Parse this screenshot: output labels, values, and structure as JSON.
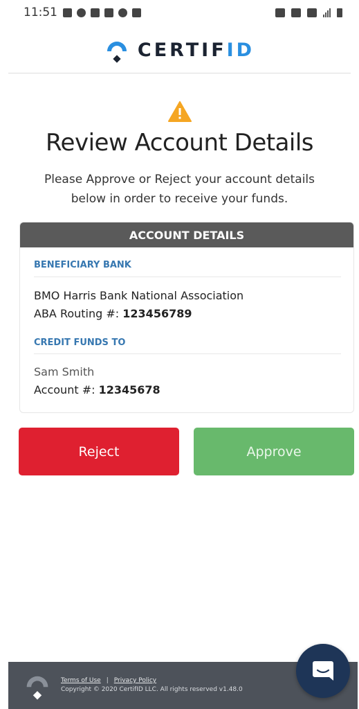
{
  "status_bar": {
    "time": "11:51",
    "icons_left": [
      "sim-icon",
      "chat-icon",
      "mail-icon",
      "message-icon",
      "sync-icon",
      "image-icon"
    ],
    "icons_right": [
      "alarm-icon",
      "mute-icon",
      "wifi-icon",
      "signal-icon",
      "battery-icon"
    ]
  },
  "header": {
    "brand_main": "CERTIF",
    "brand_accent": "ID",
    "brand_color": "#2a8fe0",
    "brand_dark": "#1b2331"
  },
  "page": {
    "warning_icon": "warning-triangle-icon",
    "warning_color": "#f5a623",
    "title": "Review Account Details",
    "subtitle": "Please Approve or Reject your account details below in order to receive your funds."
  },
  "account_card": {
    "heading": "ACCOUNT DETAILS",
    "beneficiary": {
      "label": "BENEFICIARY BANK",
      "bank_name": "BMO Harris Bank National Association",
      "routing_label": "ABA Routing #:",
      "routing_value": "123456789"
    },
    "credit": {
      "label": "CREDIT FUNDS TO",
      "name": "Sam Smith",
      "account_label": "Account #:",
      "account_value": "12345678"
    }
  },
  "actions": {
    "reject_label": "Reject",
    "approve_label": "Approve",
    "reject_color": "#df2030",
    "approve_color": "#68b96c"
  },
  "footer": {
    "terms_label": "Terms of Use",
    "separator": "|",
    "privacy_label": "Privacy Policy",
    "copyright": "Copyright © 2020 CertifID LLC. All rights reserved v1.48.0"
  },
  "chat_widget": {
    "icon": "chat-bubble-icon"
  }
}
